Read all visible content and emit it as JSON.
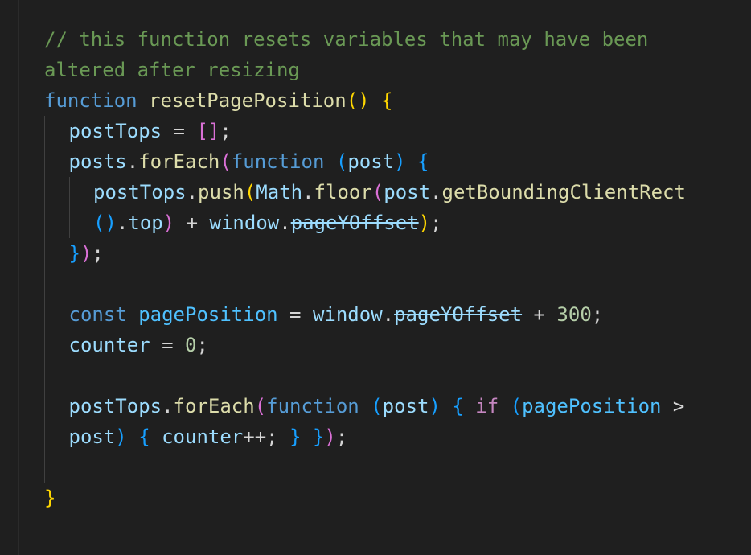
{
  "editor": {
    "lines": [
      {
        "indent": 0,
        "tokens": [
          {
            "t": "// this function resets variables that may have been",
            "k": "comment"
          }
        ]
      },
      {
        "indent": 0,
        "tokens": [
          {
            "t": "altered after resizing",
            "k": "comment"
          }
        ]
      },
      {
        "indent": 0,
        "tokens": [
          {
            "t": "function",
            "k": "keyword"
          },
          {
            "t": " ",
            "k": "plain"
          },
          {
            "t": "resetPagePosition",
            "k": "func"
          },
          {
            "t": "()",
            "k": "b1"
          },
          {
            "t": " ",
            "k": "plain"
          },
          {
            "t": "{",
            "k": "b1"
          }
        ]
      },
      {
        "indent": 1,
        "tokens": [
          {
            "t": "postTops",
            "k": "var"
          },
          {
            "t": " = ",
            "k": "plain"
          },
          {
            "t": "[]",
            "k": "b2"
          },
          {
            "t": ";",
            "k": "plain"
          }
        ]
      },
      {
        "indent": 1,
        "tokens": [
          {
            "t": "posts",
            "k": "var"
          },
          {
            "t": ".",
            "k": "plain"
          },
          {
            "t": "forEach",
            "k": "func"
          },
          {
            "t": "(",
            "k": "b2"
          },
          {
            "t": "function",
            "k": "keyword"
          },
          {
            "t": " ",
            "k": "plain"
          },
          {
            "t": "(",
            "k": "b3"
          },
          {
            "t": "post",
            "k": "var"
          },
          {
            "t": ")",
            "k": "b3"
          },
          {
            "t": " ",
            "k": "plain"
          },
          {
            "t": "{",
            "k": "b3"
          }
        ]
      },
      {
        "indent": 2,
        "tokens": [
          {
            "t": "postTops",
            "k": "var"
          },
          {
            "t": ".",
            "k": "plain"
          },
          {
            "t": "push",
            "k": "func"
          },
          {
            "t": "(",
            "k": "b1"
          },
          {
            "t": "Math",
            "k": "var"
          },
          {
            "t": ".",
            "k": "plain"
          },
          {
            "t": "floor",
            "k": "func"
          },
          {
            "t": "(",
            "k": "b2"
          },
          {
            "t": "post",
            "k": "var"
          },
          {
            "t": ".",
            "k": "plain"
          },
          {
            "t": "getBoundingClientRect",
            "k": "func"
          }
        ]
      },
      {
        "indent": 2,
        "tokens": [
          {
            "t": "()",
            "k": "b3"
          },
          {
            "t": ".",
            "k": "plain"
          },
          {
            "t": "top",
            "k": "var"
          },
          {
            "t": ")",
            "k": "b2"
          },
          {
            "t": " + ",
            "k": "plain"
          },
          {
            "t": "window",
            "k": "var"
          },
          {
            "t": ".",
            "k": "plain"
          },
          {
            "t": "pageYOffset",
            "k": "deprecated"
          },
          {
            "t": ")",
            "k": "b1"
          },
          {
            "t": ";",
            "k": "plain"
          }
        ]
      },
      {
        "indent": 1,
        "tokens": [
          {
            "t": "}",
            "k": "b3"
          },
          {
            "t": ")",
            "k": "b2"
          },
          {
            "t": ";",
            "k": "plain"
          }
        ]
      },
      {
        "indent": 1,
        "tokens": []
      },
      {
        "indent": 1,
        "tokens": [
          {
            "t": "const",
            "k": "keyword"
          },
          {
            "t": " ",
            "k": "plain"
          },
          {
            "t": "pagePosition",
            "k": "const"
          },
          {
            "t": " = ",
            "k": "plain"
          },
          {
            "t": "window",
            "k": "var"
          },
          {
            "t": ".",
            "k": "plain"
          },
          {
            "t": "pageYOffset",
            "k": "deprecated"
          },
          {
            "t": " + ",
            "k": "plain"
          },
          {
            "t": "300",
            "k": "num"
          },
          {
            "t": ";",
            "k": "plain"
          }
        ]
      },
      {
        "indent": 1,
        "tokens": [
          {
            "t": "counter",
            "k": "var"
          },
          {
            "t": " = ",
            "k": "plain"
          },
          {
            "t": "0",
            "k": "num"
          },
          {
            "t": ";",
            "k": "plain"
          }
        ]
      },
      {
        "indent": 1,
        "tokens": []
      },
      {
        "indent": 1,
        "tokens": [
          {
            "t": "postTops",
            "k": "var"
          },
          {
            "t": ".",
            "k": "plain"
          },
          {
            "t": "forEach",
            "k": "func"
          },
          {
            "t": "(",
            "k": "b2"
          },
          {
            "t": "function",
            "k": "keyword"
          },
          {
            "t": " ",
            "k": "plain"
          },
          {
            "t": "(",
            "k": "b3"
          },
          {
            "t": "post",
            "k": "var"
          },
          {
            "t": ")",
            "k": "b3"
          },
          {
            "t": " ",
            "k": "plain"
          },
          {
            "t": "{",
            "k": "b3"
          },
          {
            "t": " ",
            "k": "plain"
          },
          {
            "t": "if",
            "k": "ctrl"
          },
          {
            "t": " ",
            "k": "plain"
          },
          {
            "t": "(",
            "k": "b3"
          },
          {
            "t": "pagePosition",
            "k": "const"
          },
          {
            "t": " >",
            "k": "plain"
          }
        ]
      },
      {
        "indent": 1,
        "tokens": [
          {
            "t": "post",
            "k": "var"
          },
          {
            "t": ")",
            "k": "b3"
          },
          {
            "t": " ",
            "k": "plain"
          },
          {
            "t": "{",
            "k": "b3"
          },
          {
            "t": " ",
            "k": "plain"
          },
          {
            "t": "counter",
            "k": "var"
          },
          {
            "t": "++; ",
            "k": "plain"
          },
          {
            "t": "}",
            "k": "b3"
          },
          {
            "t": " ",
            "k": "plain"
          },
          {
            "t": "}",
            "k": "b3"
          },
          {
            "t": ")",
            "k": "b2"
          },
          {
            "t": ";",
            "k": "plain"
          }
        ]
      },
      {
        "indent": 1,
        "tokens": []
      },
      {
        "indent": 0,
        "tokens": [
          {
            "t": "}",
            "k": "b1"
          }
        ]
      }
    ]
  },
  "colors": {
    "background": "#1f1f1f",
    "comment": "#6a9955",
    "keyword": "#569cd6",
    "function": "#dcdcaa",
    "variable": "#9cdcfe",
    "constant": "#4fc1ff",
    "number": "#b5cea8",
    "bracket_gold": "#ffd700",
    "bracket_orchid": "#da70d6",
    "bracket_blue": "#179fff"
  }
}
